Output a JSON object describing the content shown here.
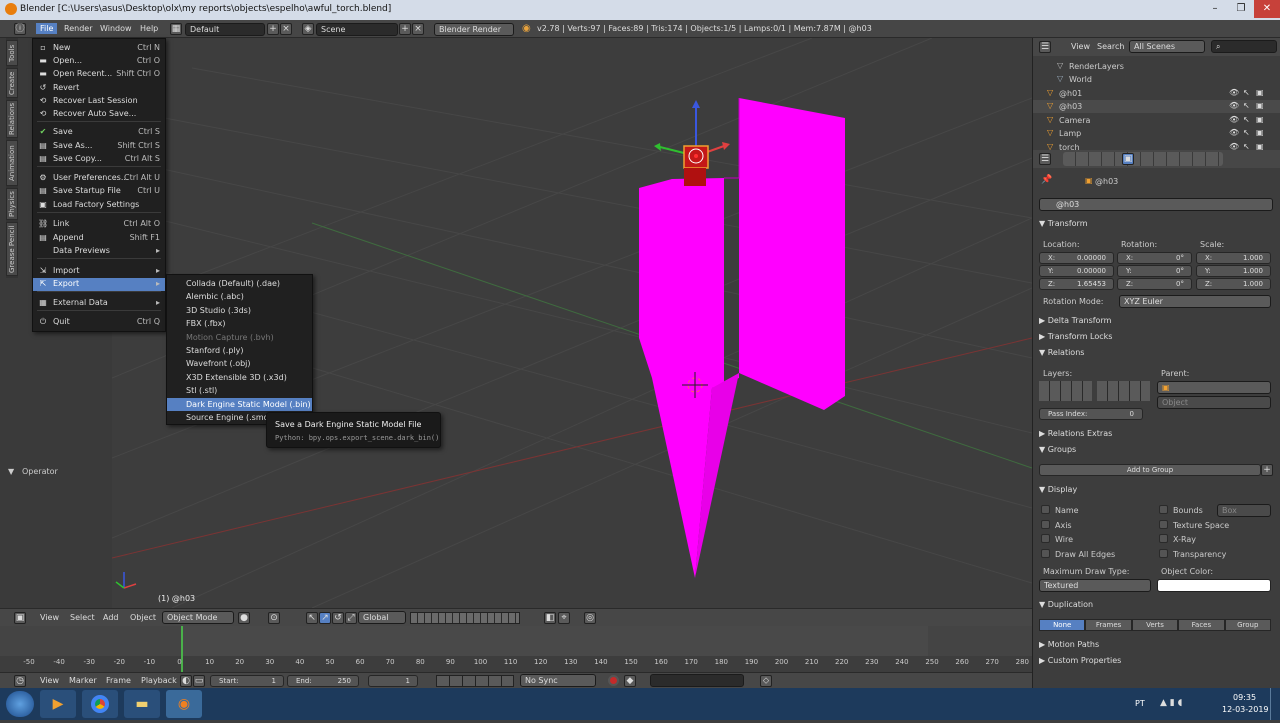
{
  "window": {
    "title": "Blender [C:\\Users\\asus\\Desktop\\olx\\my reports\\objects\\espelho\\awful_torch.blend]"
  },
  "infobar": {
    "menus": [
      "File",
      "Render",
      "Window",
      "Help"
    ],
    "layout": "Default",
    "scene": "Scene",
    "engine": "Blender Render",
    "stats": "v2.78 | Verts:97 | Faces:89 | Tris:174 | Objects:1/5 | Lamps:0/1 | Mem:7.87M | @h03"
  },
  "left_tabs": [
    "Tools",
    "Create",
    "Relations",
    "Animation",
    "Physics",
    "Grease Pencil"
  ],
  "operator_panel": {
    "title": "Operator"
  },
  "file_menu": {
    "items": [
      {
        "label": "New",
        "shortcut": "Ctrl N",
        "icon": "new-file-icon"
      },
      {
        "label": "Open...",
        "shortcut": "Ctrl O",
        "icon": "folder-icon"
      },
      {
        "label": "Open Recent...",
        "shortcut": "Shift Ctrl O",
        "icon": "folder-recent-icon"
      },
      {
        "label": "Revert",
        "shortcut": "",
        "icon": "revert-icon"
      },
      {
        "label": "Recover Last Session",
        "shortcut": "",
        "icon": "recover-icon"
      },
      {
        "label": "Recover Auto Save...",
        "shortcut": "",
        "icon": "recover-auto-icon"
      },
      {
        "label": "Save",
        "shortcut": "Ctrl S",
        "icon": "check-icon"
      },
      {
        "label": "Save As...",
        "shortcut": "Shift Ctrl S",
        "icon": "save-as-icon"
      },
      {
        "label": "Save Copy...",
        "shortcut": "Ctrl Alt S",
        "icon": "save-copy-icon"
      },
      {
        "label": "User Preferences...",
        "shortcut": "Ctrl Alt U",
        "icon": "preferences-icon"
      },
      {
        "label": "Save Startup File",
        "shortcut": "Ctrl U",
        "icon": "save-startup-icon"
      },
      {
        "label": "Load Factory Settings",
        "shortcut": "",
        "icon": "factory-icon"
      },
      {
        "label": "Link",
        "shortcut": "Ctrl Alt O",
        "icon": "link-icon"
      },
      {
        "label": "Append",
        "shortcut": "Shift F1",
        "icon": "append-icon"
      },
      {
        "label": "Data Previews",
        "shortcut": "▸",
        "icon": ""
      },
      {
        "label": "Import",
        "shortcut": "▸",
        "icon": "import-icon"
      },
      {
        "label": "Export",
        "shortcut": "▸",
        "icon": "export-icon"
      },
      {
        "label": "External Data",
        "shortcut": "▸",
        "icon": "external-data-icon"
      },
      {
        "label": "Quit",
        "shortcut": "Ctrl Q",
        "icon": "quit-icon"
      }
    ]
  },
  "export_menu": {
    "items": [
      {
        "label": "Collada (Default) (.dae)",
        "disabled": false
      },
      {
        "label": "Alembic (.abc)",
        "disabled": false
      },
      {
        "label": "3D Studio (.3ds)",
        "disabled": false
      },
      {
        "label": "FBX (.fbx)",
        "disabled": false
      },
      {
        "label": "Motion Capture (.bvh)",
        "disabled": true
      },
      {
        "label": "Stanford (.ply)",
        "disabled": false
      },
      {
        "label": "Wavefront (.obj)",
        "disabled": false
      },
      {
        "label": "X3D Extensible 3D (.x3d)",
        "disabled": false
      },
      {
        "label": "Stl (.stl)",
        "disabled": false
      },
      {
        "label": "Dark Engine Static Model (.bin)",
        "disabled": false
      },
      {
        "label": "Source Engine (.smd, .vt",
        "disabled": false
      }
    ]
  },
  "tooltip": {
    "title": "Save a Dark Engine Static Model File",
    "python": "Python: bpy.ops.export_scene.dark_bin()"
  },
  "viewport": {
    "object_label": "(1) @h03",
    "mesh_color": "#ff00ff"
  },
  "viewport_header": {
    "items": [
      "View",
      "Select",
      "Add",
      "Object"
    ],
    "mode": "Object Mode",
    "orientation": "Global"
  },
  "timeline": {
    "ticks": [
      "-50",
      "-40",
      "-30",
      "-20",
      "-10",
      "0",
      "10",
      "20",
      "30",
      "40",
      "50",
      "60",
      "70",
      "80",
      "90",
      "100",
      "110",
      "120",
      "130",
      "140",
      "150",
      "160",
      "170",
      "180",
      "190",
      "200",
      "210",
      "220",
      "230",
      "240",
      "250",
      "260",
      "270",
      "280"
    ],
    "menus": [
      "View",
      "Marker",
      "Frame",
      "Playback"
    ],
    "start_label": "Start:",
    "start": "1",
    "end_label": "End:",
    "end": "250",
    "current": "1",
    "sync": "No Sync"
  },
  "outliner": {
    "header": {
      "view": "View",
      "search": "Search",
      "filter": "All Scenes"
    },
    "items": [
      "Scene",
      "RenderLayers",
      "World",
      "@h01",
      "@h03",
      "Camera",
      "Lamp",
      "torch"
    ]
  },
  "properties": {
    "object_name": "@h03",
    "breadcrumb": "@h03",
    "transform": {
      "title": "Transform",
      "location_label": "Location:",
      "rotation_label": "Rotation:",
      "scale_label": "Scale:",
      "location": [
        "X:",
        "0.00000",
        "Y:",
        "0.00000",
        "Z:",
        "1.65453"
      ],
      "rotation": [
        "X:",
        "0°",
        "Y:",
        "0°",
        "Z:",
        "0°"
      ],
      "scale": [
        "X:",
        "1.000",
        "Y:",
        "1.000",
        "Z:",
        "1.000"
      ],
      "rotation_mode_label": "Rotation Mode:",
      "rotation_mode": "XYZ Euler"
    },
    "panels_collapsed": [
      "Delta Transform",
      "Transform Locks"
    ],
    "relations": {
      "title": "Relations",
      "layers_label": "Layers:",
      "parent_label": "Parent:",
      "parent_type": "Object",
      "pass_index_label": "Pass Index:",
      "pass_index": "0"
    },
    "relations_extras": "Relations Extras",
    "groups": {
      "title": "Groups",
      "add_button": "Add to Group"
    },
    "display": {
      "title": "Display",
      "checks_left": [
        "Name",
        "Axis",
        "Wire",
        "Draw All Edges"
      ],
      "checks_right": [
        "Bounds",
        "Texture Space",
        "X-Ray",
        "Transparency"
      ],
      "bounds_type": "Box",
      "max_draw_label": "Maximum Draw Type:",
      "max_draw": "Textured",
      "object_color_label": "Object Color:"
    },
    "duplication": {
      "title": "Duplication",
      "options": [
        "None",
        "Frames",
        "Verts",
        "Faces",
        "Group"
      ],
      "selected": "None"
    },
    "motion_paths": "Motion Paths",
    "custom_properties": "Custom Properties"
  },
  "taskbar": {
    "lang": "PT",
    "time": "09:35",
    "date": "12-03-2019"
  }
}
